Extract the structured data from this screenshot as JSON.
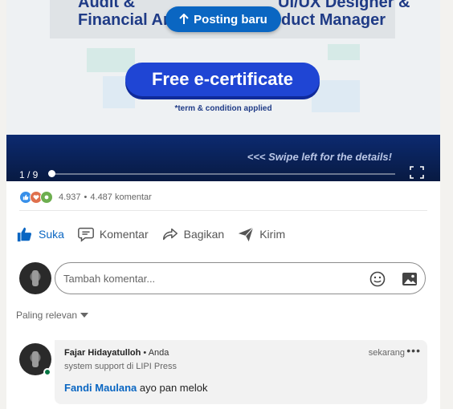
{
  "posting_baru": {
    "label": "Posting baru"
  },
  "carousel": {
    "title_left_lines": [
      "Audit &",
      "Financial An"
    ],
    "title_right_lines": [
      "UI/UX Designer &",
      "roduct Manager"
    ],
    "cta_label": "Free e-certificate",
    "cta_note": "*term & condition applied",
    "swipe_text": "<<< Swipe left for the details!",
    "counter": "1 / 9",
    "progress": 0.0
  },
  "social": {
    "reactions": [
      "like",
      "love",
      "celebrate"
    ],
    "reaction_count": "4.937",
    "separator": "•",
    "comment_count": "4.487 komentar"
  },
  "actions": [
    {
      "label": "Suka",
      "icon": "thumbs-up-icon"
    },
    {
      "label": "Komentar",
      "icon": "comment-icon"
    },
    {
      "label": "Bagikan",
      "icon": "share-icon"
    },
    {
      "label": "Kirim",
      "icon": "send-icon"
    }
  ],
  "comment_box": {
    "placeholder": "Tambah komentar..."
  },
  "sort": {
    "label": "Paling relevan"
  },
  "comment": {
    "author": "Fajar Hidayatulloh",
    "relation": "• Anda",
    "headline": "system support di LIPI Press",
    "time": "sekarang",
    "more": "•••",
    "mention": "Fandi Maulana",
    "text": " ayo pan melok"
  },
  "colors": {
    "accent": "#0a66c2",
    "cta_blue": "#1f45d4",
    "online": "#057642"
  }
}
